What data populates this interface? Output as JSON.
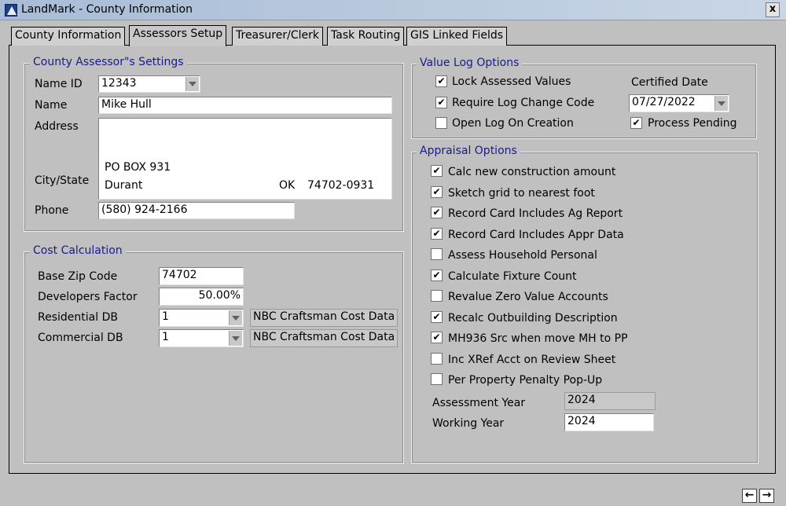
{
  "window": {
    "title": "LandMark - County Information",
    "close_label": "x"
  },
  "tabs": [
    {
      "label": "County Information"
    },
    {
      "label": "Assessors Setup"
    },
    {
      "label": "Treasurer/Clerk"
    },
    {
      "label": "Task Routing"
    },
    {
      "label": "GIS Linked Fields"
    }
  ],
  "assessor": {
    "legend": "County Assessor\"s Settings",
    "name_id_label": "Name ID",
    "name_id_value": "12343",
    "name_label": "Name",
    "name_value": "Mike Hull",
    "address_label": "Address",
    "address_line1": "PO BOX 931",
    "city_state_label": "City/State",
    "city": "Durant",
    "state": "OK",
    "zip": "74702-0931",
    "phone_label": "Phone",
    "phone_value": "(580) 924-2166"
  },
  "cost": {
    "legend": "Cost Calculation",
    "base_zip_label": "Base Zip Code",
    "base_zip_value": "74702",
    "dev_factor_label": "Developers Factor",
    "dev_factor_value": "50.00%",
    "res_db_label": "Residential DB",
    "res_db_value": "1",
    "res_db_name": "NBC Craftsman Cost Data",
    "com_db_label": "Commercial DB",
    "com_db_value": "1",
    "com_db_name": "NBC Craftsman Cost Data"
  },
  "value_log": {
    "legend": "Value Log Options",
    "options": [
      {
        "label": "Lock Assessed Values",
        "checked": true
      },
      {
        "label": "Require Log Change Code",
        "checked": true
      },
      {
        "label": "Open Log On Creation",
        "checked": false
      }
    ],
    "certified_date_label": "Certified Date",
    "certified_date_value": "07/27/2022",
    "process_pending_label": "Process Pending",
    "process_pending_checked": true
  },
  "appraisal": {
    "legend": "Appraisal Options",
    "options": [
      {
        "label": "Calc new construction amount",
        "checked": true
      },
      {
        "label": "Sketch grid to nearest foot",
        "checked": true
      },
      {
        "label": "Record Card Includes Ag Report",
        "checked": true
      },
      {
        "label": "Record Card Includes Appr Data",
        "checked": true
      },
      {
        "label": "Assess Household Personal",
        "checked": false
      },
      {
        "label": "Calculate Fixture Count",
        "checked": true
      },
      {
        "label": "Revalue Zero Value Accounts",
        "checked": false
      },
      {
        "label": "Recalc Outbuilding Description",
        "checked": true
      },
      {
        "label": "MH936 Src when move MH to PP",
        "checked": true
      },
      {
        "label": "Inc XRef Acct on Review Sheet",
        "checked": false
      },
      {
        "label": "Per Property Penalty Pop-Up",
        "checked": false
      }
    ],
    "assessment_year_label": "Assessment Year",
    "assessment_year_value": "2024",
    "working_year_label": "Working Year",
    "working_year_value": "2024"
  },
  "nav": {
    "prev_label": "◆",
    "next_label": "➜"
  },
  "check_glyph": "✔"
}
